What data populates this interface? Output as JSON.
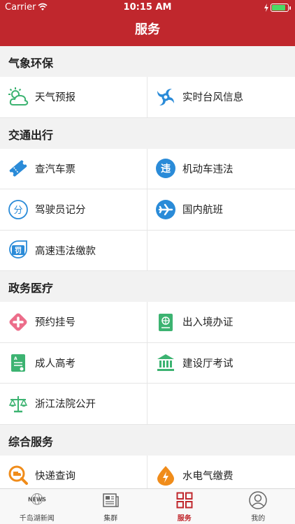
{
  "status": {
    "carrier": "Carrier",
    "time": "10:15 AM"
  },
  "nav": {
    "title": "服务"
  },
  "sections": [
    {
      "title": "气象环保",
      "items": [
        {
          "label": "天气预报",
          "icon": "weather-icon"
        },
        {
          "label": "实时台风信息",
          "icon": "typhoon-icon"
        }
      ]
    },
    {
      "title": "交通出行",
      "items": [
        {
          "label": "查汽车票",
          "icon": "ticket-icon"
        },
        {
          "label": "机动车违法",
          "icon": "violation-icon"
        },
        {
          "label": "驾驶员记分",
          "icon": "score-icon"
        },
        {
          "label": "国内航班",
          "icon": "airplane-icon"
        },
        {
          "label": "高速违法缴款",
          "icon": "fine-icon"
        }
      ]
    },
    {
      "title": "政务医疗",
      "items": [
        {
          "label": "预约挂号",
          "icon": "medical-cross-icon"
        },
        {
          "label": "出入境办证",
          "icon": "passport-icon"
        },
        {
          "label": "成人高考",
          "icon": "document-icon"
        },
        {
          "label": "建设厅考试",
          "icon": "building-icon"
        },
        {
          "label": "浙江法院公开",
          "icon": "scales-icon"
        }
      ]
    },
    {
      "title": "综合服务",
      "items": [
        {
          "label": "快递查询",
          "icon": "delivery-search-icon"
        },
        {
          "label": "水电气缴费",
          "icon": "utility-icon"
        }
      ]
    }
  ],
  "tabs": [
    {
      "label": "千岛湖新闻",
      "icon": "news-icon",
      "active": false,
      "icon_text": "NEWS"
    },
    {
      "label": "集群",
      "icon": "newspaper-icon",
      "active": false
    },
    {
      "label": "服务",
      "icon": "grid-icon",
      "active": true
    },
    {
      "label": "我的",
      "icon": "profile-icon",
      "active": false
    }
  ],
  "colors": {
    "brand": "#c0272d",
    "blue": "#2a8bd8",
    "green": "#3cb371",
    "pink": "#ec6d8a",
    "orange": "#f08c1a"
  }
}
